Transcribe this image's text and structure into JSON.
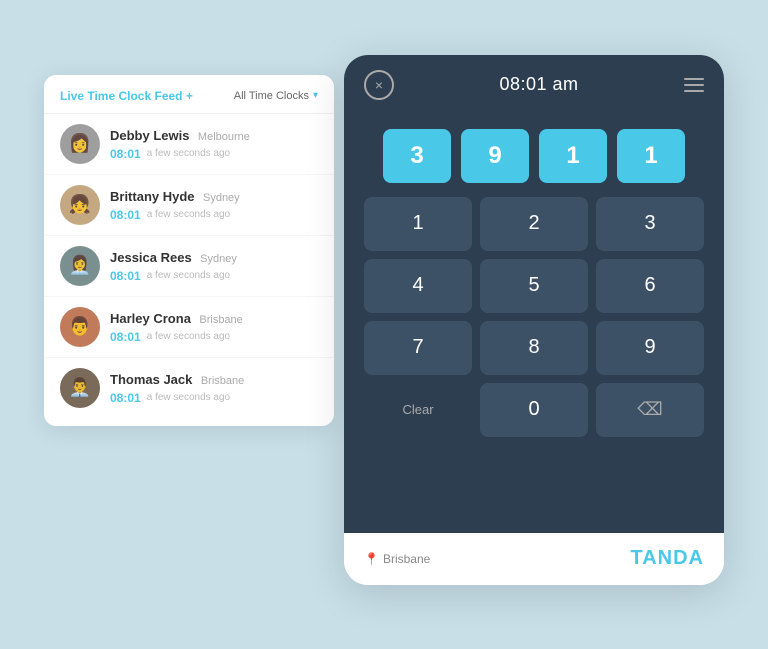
{
  "feed": {
    "title": "Live Time Clock Feed",
    "title_plus": "+",
    "filter_label": "All Time Clocks",
    "items": [
      {
        "name": "Debby Lewis",
        "location": "Melbourne",
        "time": "08:01",
        "ago": "a few seconds ago",
        "avatar_color": "#9e9e9e",
        "avatar_icon": "👩"
      },
      {
        "name": "Brittany Hyde",
        "location": "Sydney",
        "time": "08:01",
        "ago": "a few seconds ago",
        "avatar_color": "#c4a882",
        "avatar_icon": "👧"
      },
      {
        "name": "Jessica Rees",
        "location": "Sydney",
        "time": "08:01",
        "ago": "a few seconds ago",
        "avatar_color": "#7a9090",
        "avatar_icon": "👩‍💼"
      },
      {
        "name": "Harley Crona",
        "location": "Brisbane",
        "time": "08:01",
        "ago": "a few seconds ago",
        "avatar_color": "#c17a5a",
        "avatar_icon": "👨"
      },
      {
        "name": "Thomas Jack",
        "location": "Brisbane",
        "time": "08:01",
        "ago": "a few seconds ago",
        "avatar_color": "#7a6a5a",
        "avatar_icon": "👨‍💼"
      }
    ]
  },
  "tablet": {
    "time": "08:01 am",
    "pin_digits": [
      "3",
      "9",
      "1",
      "1"
    ],
    "numpad": [
      [
        "1",
        "2",
        "3"
      ],
      [
        "4",
        "5",
        "6"
      ],
      [
        "7",
        "8",
        "9"
      ],
      [
        "Clear",
        "0",
        "⌫"
      ]
    ],
    "location": "Brisbane",
    "brand": "TANDA",
    "close_label": "×",
    "menu_lines": 3
  },
  "colors": {
    "background": "#c8dfe8",
    "accent": "#4ac8e8",
    "dark_panel": "#2c3e50",
    "key_bg": "#3d5166",
    "white": "#ffffff"
  }
}
